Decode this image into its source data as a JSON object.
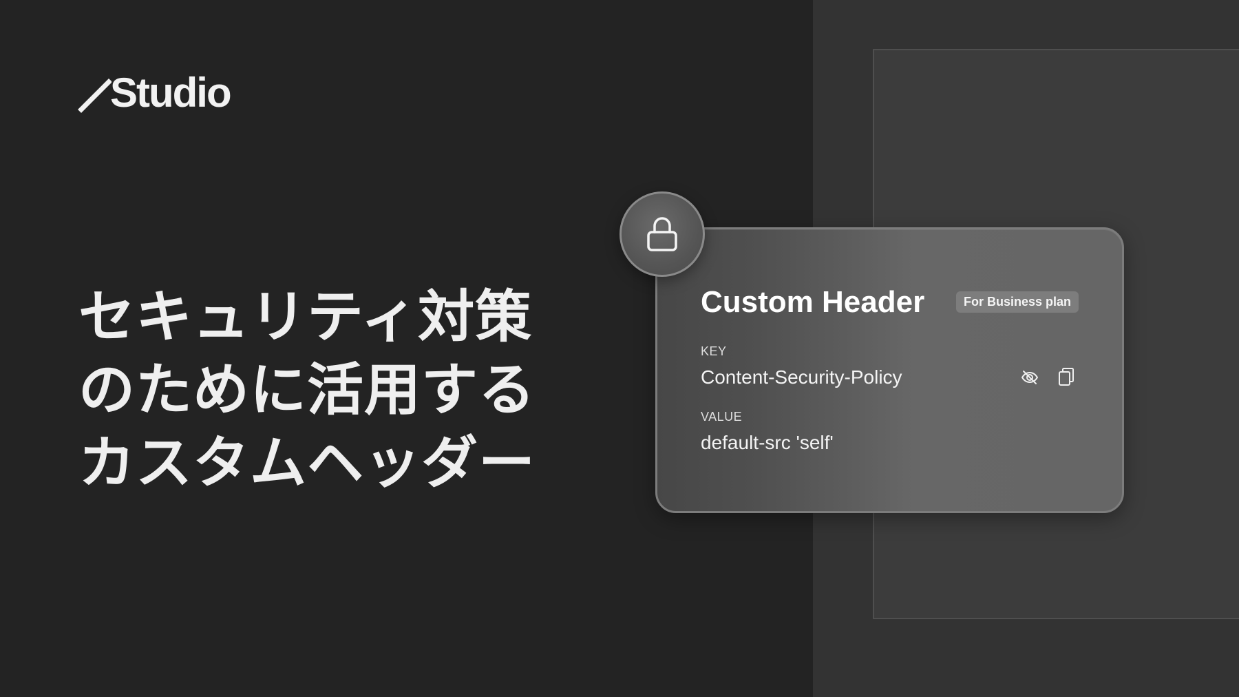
{
  "logo": {
    "text": "Studio",
    "icon": "slash-icon"
  },
  "headline": {
    "lines": [
      "セキュリティ対策",
      "のために活用する",
      "カスタムヘッダー"
    ]
  },
  "card": {
    "title": "Custom Header",
    "badge": "For Business plan",
    "key_label": "KEY",
    "key_value": "Content-Security-Policy",
    "value_label": "VALUE",
    "value_value": "default-src 'self'",
    "icons": {
      "lock": "lock-icon",
      "visibility": "eye-off-icon",
      "copy": "copy-icon"
    }
  },
  "colors": {
    "background_left": "#232323",
    "background_right": "#333333",
    "card": "#5e5e5e",
    "badge": "#7d7d7d",
    "text": "#f2f2f2"
  }
}
